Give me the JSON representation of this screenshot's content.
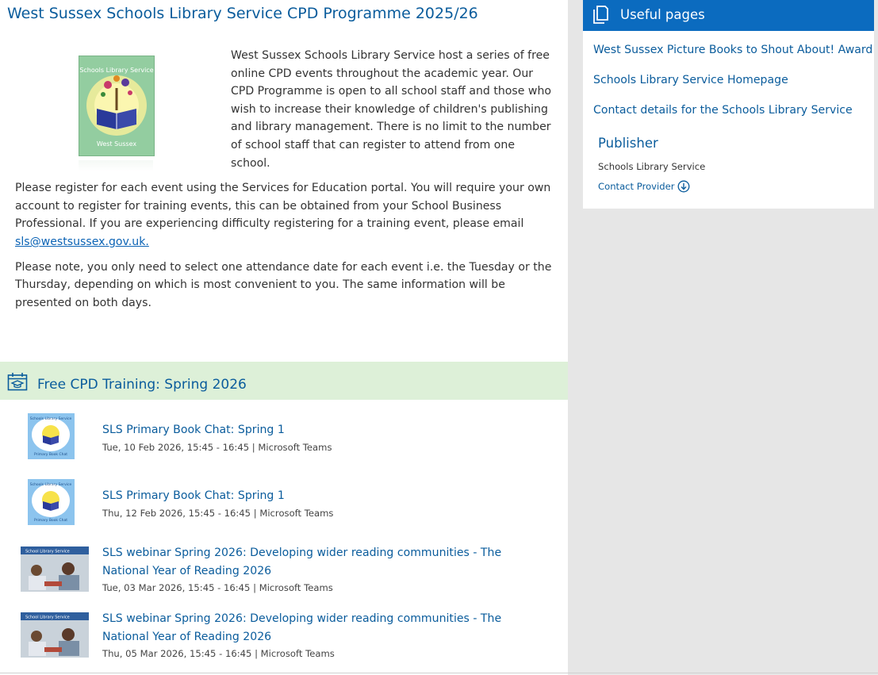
{
  "page": {
    "title": "West Sussex Schools Library Service CPD Programme 2025/26"
  },
  "intro": {
    "paragraph1": "West Sussex Schools Library Service host a series of free online CPD events throughout the academic year. Our CPD Programme is open to all school staff and those who wish to increase their knowledge of children's publishing and library management. There is no limit to the number of school staff that can register to attend from one school.",
    "paragraph2_text": "Please register for each event using the Services for Education portal. You will require your own account to register for training events, this can be obtained from your School Business Professional. If you are experiencing difficulty registering for a training event, please email ",
    "email_link": "sls@westsussex.gov.uk.",
    "paragraph3": "Please note, you only need to select one attendance date for each event i.e. the Tuesday or the Thursday, depending on which is most convenient to you. The same information will be presented on both days."
  },
  "logo": {
    "top_text": "Schools Library Service",
    "bottom_text": "West Sussex"
  },
  "cpd_section": {
    "title": "Free CPD Training: Spring 2026",
    "icon": "calendar-graduation-icon",
    "events": [
      {
        "title": "SLS Primary Book Chat: Spring 1",
        "meta": "Tue, 10 Feb 2026, 15:45 - 16:45 | Microsoft Teams",
        "thumb": "book-chat-thumbnail"
      },
      {
        "title": "SLS Primary Book Chat: Spring 1",
        "meta": "Thu, 12 Feb 2026, 15:45 - 16:45 | Microsoft Teams",
        "thumb": "book-chat-thumbnail"
      },
      {
        "title": "SLS webinar Spring 2026: Developing wider reading communities - The National Year of Reading 2026",
        "meta": "Tue, 03 Mar 2026, 15:45 - 16:45 | Microsoft Teams",
        "thumb": "webinar-photo-thumbnail"
      },
      {
        "title": "SLS webinar Spring 2026: Developing wider reading communities - The National Year of Reading 2026",
        "meta": "Thu, 05 Mar 2026, 15:45 - 16:45 | Microsoft Teams",
        "thumb": "webinar-photo-thumbnail"
      }
    ]
  },
  "sidebar": {
    "useful_pages_title": "Useful pages",
    "links": [
      "West Sussex Picture Books to Shout About! Award",
      "Schools Library Service Homepage",
      "Contact details for the Schools Library Service"
    ],
    "publisher_heading": "Publisher",
    "publisher_name": "Schools Library Service",
    "contact_provider": "Contact Provider"
  },
  "colors": {
    "link_blue": "#0a5c9c",
    "header_blue": "#0b6bbf",
    "section_green": "#ddf0d8",
    "page_grey": "#e6e6e6"
  }
}
